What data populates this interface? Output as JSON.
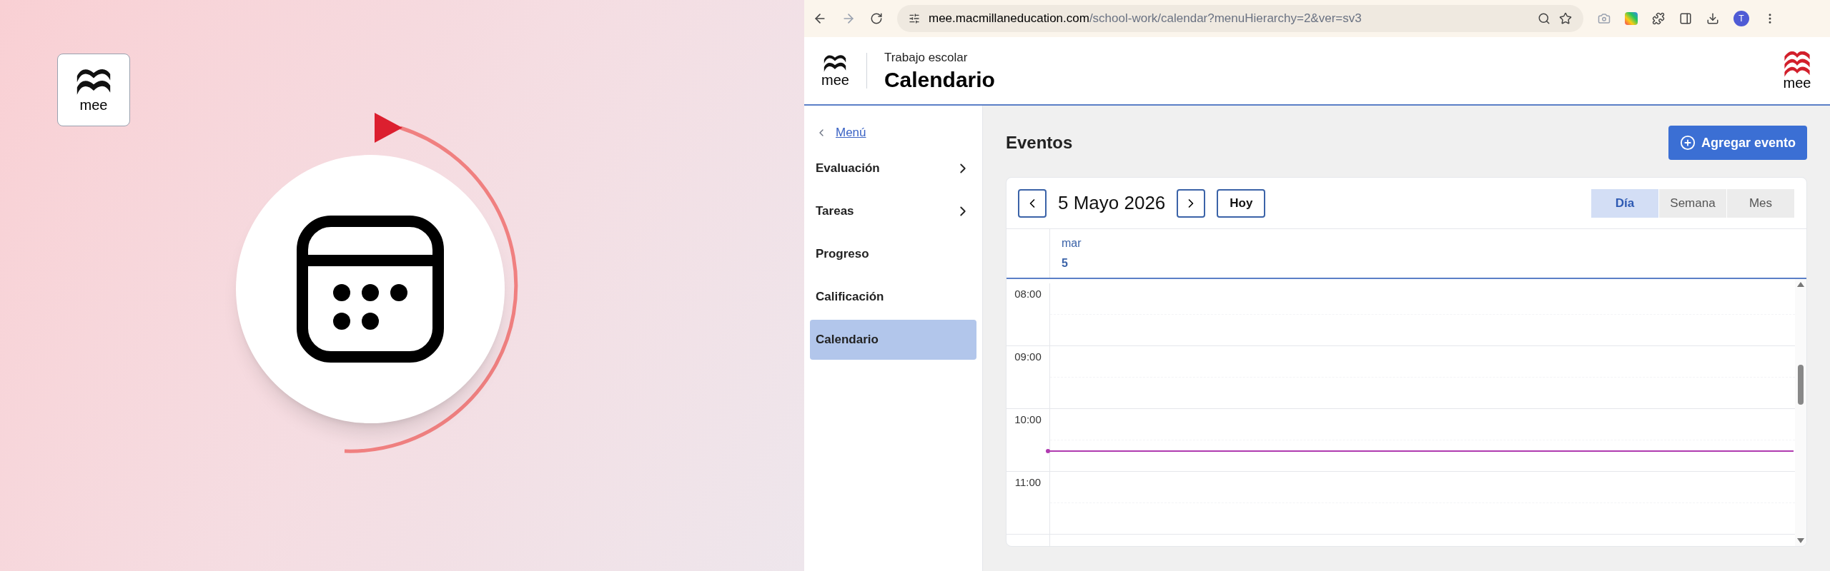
{
  "promo": {
    "logo_text": "mee"
  },
  "browser": {
    "url_host": "mee.macmillaneducation.com",
    "url_path": "/school-work/calendar?menuHierarchy=2&ver=sv3",
    "profile_initial": "T"
  },
  "header": {
    "logo_text": "mee",
    "section": "Trabajo escolar",
    "title": "Calendario",
    "brand_text": "mee"
  },
  "sidebar": {
    "back_link": "Menú",
    "items": [
      {
        "label": "Evaluación",
        "has_submenu": true,
        "selected": false
      },
      {
        "label": "Tareas",
        "has_submenu": true,
        "selected": false
      },
      {
        "label": "Progreso",
        "has_submenu": false,
        "selected": false
      },
      {
        "label": "Calificación",
        "has_submenu": false,
        "selected": false
      },
      {
        "label": "Calendario",
        "has_submenu": false,
        "selected": true
      }
    ]
  },
  "main": {
    "heading": "Eventos",
    "add_button": "Agregar evento"
  },
  "calendar": {
    "date": "5 Mayo 2026",
    "today_button": "Hoy",
    "views": [
      {
        "label": "Día",
        "selected": true
      },
      {
        "label": "Semana",
        "selected": false
      },
      {
        "label": "Mes",
        "selected": false
      }
    ],
    "day_name": "mar",
    "day_number": "5",
    "hours": [
      "08:00",
      "09:00",
      "10:00",
      "11:00"
    ]
  }
}
